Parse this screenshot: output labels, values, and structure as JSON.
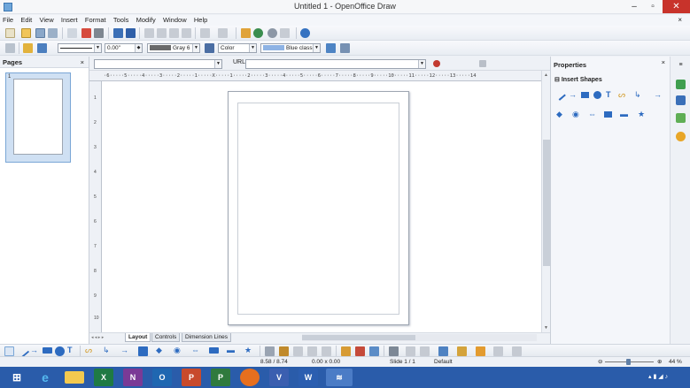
{
  "window": {
    "title": "Untitled 1 - OpenOffice Draw",
    "min": "–",
    "max": "▫",
    "close": "✕"
  },
  "menu": [
    "File",
    "Edit",
    "View",
    "Insert",
    "Format",
    "Tools",
    "Modify",
    "Window",
    "Help"
  ],
  "menu_close": "×",
  "line_toolbar": {
    "line_width": "0.00\"",
    "color_name": "Gray 6",
    "area_style": "Color",
    "area_color": "Blue classic",
    "colors": {
      "gray6": "#6a6a6a",
      "blue_classic": "#8eb3e4"
    }
  },
  "pages_pane": {
    "title": "Pages",
    "close": "×",
    "page_number": "1"
  },
  "url_bar": {
    "label": "URL:"
  },
  "ruler": {
    "h_text": "·6·····5·····4·····3·····2·····1·····X·····1·····2·····3·····4·····5·····6·····7·····8·····9·····10·····11·····12·····13·····14",
    "v_marks": [
      "1",
      "2",
      "3",
      "4",
      "5",
      "6",
      "7",
      "8",
      "9",
      "10"
    ]
  },
  "tabs": [
    {
      "label": "Layout",
      "active": true
    },
    {
      "label": "Controls",
      "active": false
    },
    {
      "label": "Dimension Lines",
      "active": false
    }
  ],
  "properties": {
    "title": "Properties",
    "close": "×",
    "section": "Insert Shapes"
  },
  "status": {
    "position": "8.58 / 8.74",
    "size": "0.00 x 0.00",
    "slide": "Slide 1 / 1",
    "master": "Default",
    "zoom": "44 %"
  },
  "taskbar": {
    "apps": [
      "windows-start",
      "internet-explorer",
      "file-explorer",
      "excel",
      "onenote",
      "outlook",
      "powerpoint",
      "project",
      "firefox",
      "visio",
      "word",
      "openoffice"
    ],
    "labels": {
      "excel": "X",
      "onenote": "N",
      "outlook": "O",
      "powerpoint": "P",
      "project": "P",
      "visio": "V",
      "word": "W"
    },
    "accent": "#2a5caa"
  }
}
